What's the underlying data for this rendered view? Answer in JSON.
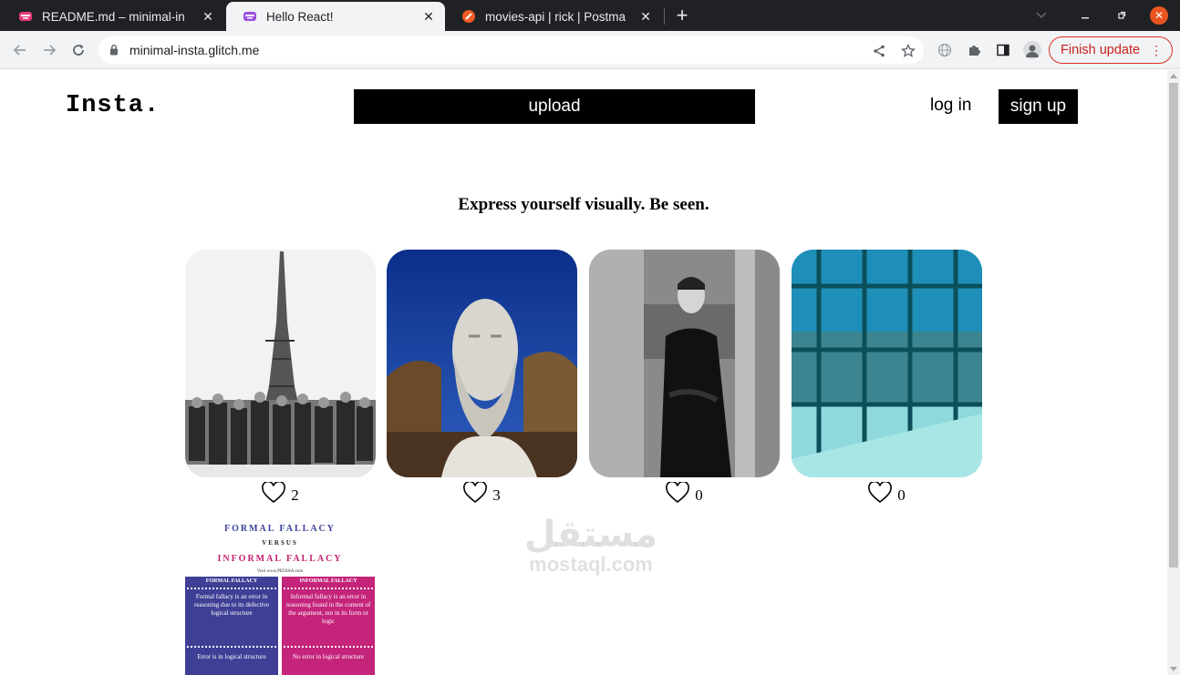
{
  "browser": {
    "tabs": [
      {
        "title": "README.md – minimal-in",
        "active": false
      },
      {
        "title": "Hello React!",
        "active": true
      },
      {
        "title": "movies-api | rick | Postma",
        "active": false
      }
    ],
    "url": "minimal-insta.glitch.me",
    "finish_update_label": "Finish update",
    "accent_color": "#e95420"
  },
  "header": {
    "logo": "Insta.",
    "upload_label": "upload",
    "login_label": "log in",
    "signup_label": "sign up"
  },
  "tagline": "Express yourself visually. Be seen.",
  "posts": [
    {
      "subject": "eiffel-tower-photo",
      "likes": "2"
    },
    {
      "subject": "statue-bust-photo",
      "likes": "3"
    },
    {
      "subject": "man-portrait-photo",
      "likes": "0"
    },
    {
      "subject": "window-city-view-photo",
      "likes": "0"
    }
  ],
  "infographic": {
    "title": "FORMAL FALLACY",
    "versus": "VERSUS",
    "subtitle": "INFORMAL FALLACY",
    "source": "Visit www.PEDIAA.com",
    "left_heading": "FORMAL FALLACY",
    "left_text": "Formal fallacy is an error in reasoning due to its defective logical structure",
    "left_footer": "Error is in logical structure",
    "right_heading": "INFORMAL FALLACY",
    "right_text": "Informal fallacy is an error in reasoning found in the content of the argument, not in its form or logic",
    "right_footer": "No error in logical structure"
  },
  "watermark": {
    "arabic": "مستقل",
    "latin": "mostaql.com"
  }
}
